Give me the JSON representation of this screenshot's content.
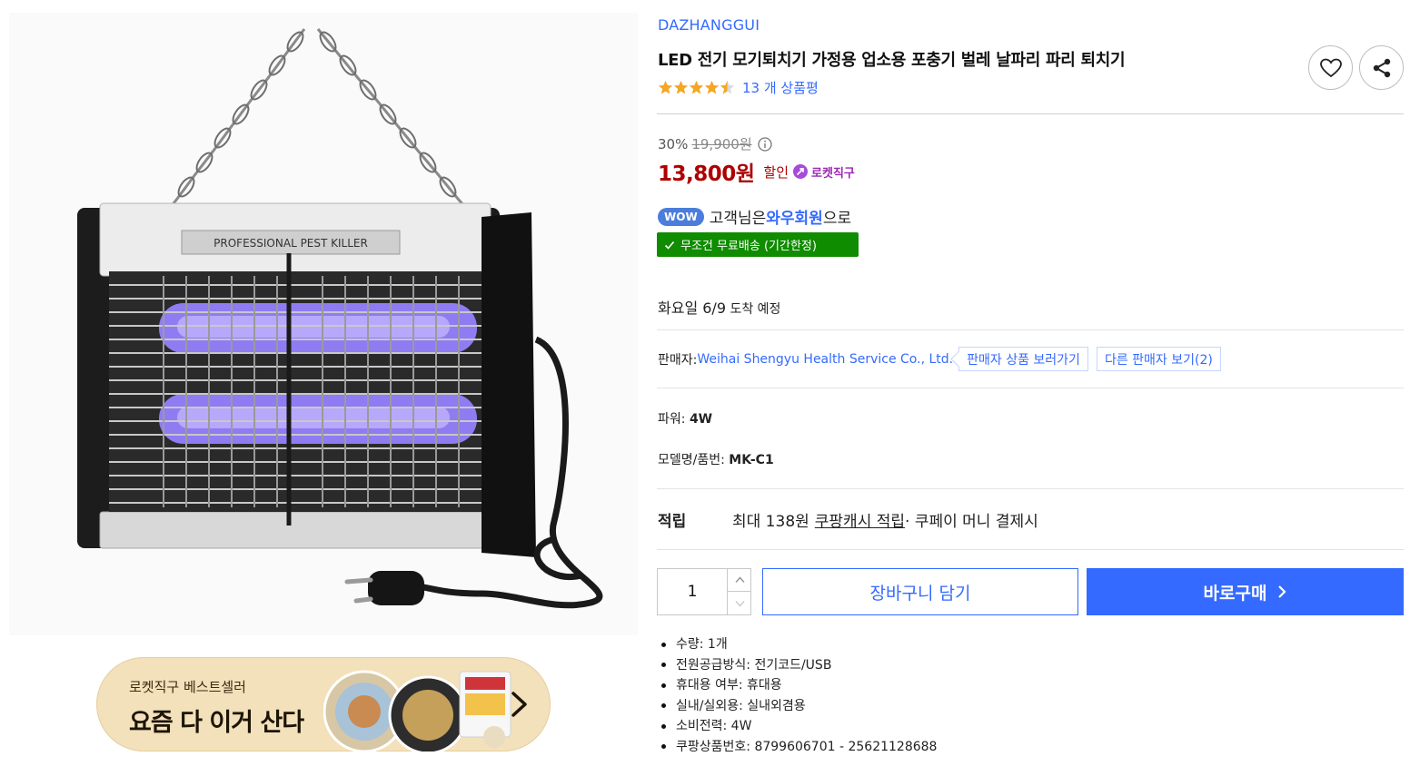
{
  "product": {
    "brand": "DAZHANGGUI",
    "title": "LED 전기 모기퇴치기 가정용 업소용 포충기 벌레 날파리 파리 퇴치기",
    "image_text": "PROFESSIONAL PEST KILLER",
    "rating": 4.5,
    "review_count_text": "13 개 상품평"
  },
  "price": {
    "discount_rate": "30%",
    "original": "19,900원",
    "sale": "13,800원",
    "sale_tag": "할인",
    "rocket_label": "로켓직구"
  },
  "wow": {
    "pill": "WOW",
    "prefix": "고객님은 ",
    "member": "와우회원",
    "suffix": "으로"
  },
  "shipping": {
    "free_label": "무조건 무료배송 (기간한정)"
  },
  "delivery": {
    "day": "화요일 6/9",
    "note": " 도착 예정"
  },
  "seller": {
    "label": "판매자: ",
    "name": "Weihai Shengyu Health Service Co., Ltd.",
    "view_products": "판매자 상품 보러가기",
    "other_sellers": "다른 판매자 보기(2)"
  },
  "attributes": {
    "power_label": "파워: ",
    "power_value": "4W",
    "model_label": "모델명/품번: ",
    "model_value": "MK-C1"
  },
  "points": {
    "label": "적립",
    "prefix": "최대 138원 ",
    "link": "쿠팡캐시 적립",
    "suffix": " · 쿠페이 머니 결제시"
  },
  "purchase": {
    "quantity": "1",
    "cart_label": "장바구니 담기",
    "buy_label": "바로구매"
  },
  "specs": [
    "수량: 1개",
    "전원공급방식: 전기코드/USB",
    "휴대용 여부: 휴대용",
    "실내/실외용: 실내외겸용",
    "소비전력: 4W",
    "쿠팡상품번호: 8799606701 - 25621128688"
  ],
  "banner": {
    "subtitle": "로켓직구 베스트셀러",
    "title": "요즘 다 이거 산다"
  },
  "colors": {
    "accent": "#346aff",
    "sale_red": "#ae0000",
    "free_ship_green": "#108c00",
    "rocket_purple": "#9b29b3",
    "star": "#f5a623"
  },
  "icons": [
    "heart-icon",
    "share-icon",
    "star-icon",
    "info-icon",
    "rocket-icon",
    "check-icon",
    "chevron-up-icon",
    "chevron-down-icon",
    "chevron-right-icon"
  ]
}
